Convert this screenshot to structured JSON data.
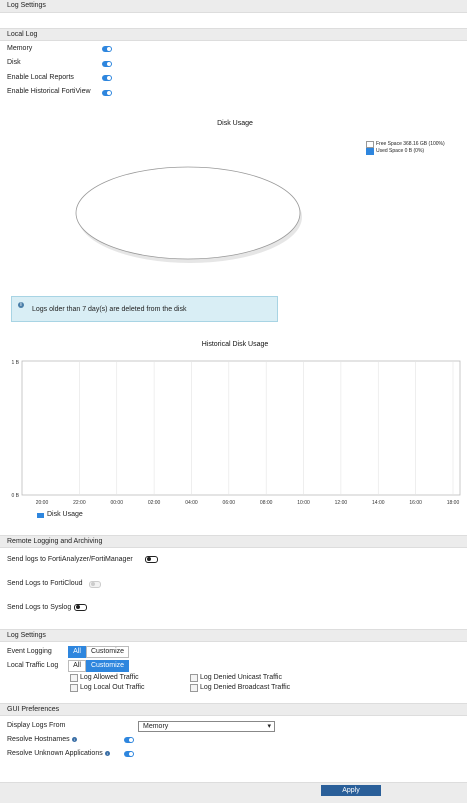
{
  "header": {
    "title": "Log Settings"
  },
  "local_log": {
    "section_title": "Local Log",
    "items": [
      {
        "label": "Memory",
        "enabled": true
      },
      {
        "label": "Disk",
        "enabled": true
      },
      {
        "label": "Enable Local Reports",
        "enabled": true
      },
      {
        "label": "Enable Historical FortiView",
        "enabled": true
      }
    ]
  },
  "disk_usage": {
    "title": "Disk Usage",
    "legend_free": "Free Space 368.16 GB (100%)",
    "legend_used": "Used Space 0 B (0%)",
    "free_color": "#ffffff",
    "used_color": "#2e86de"
  },
  "info_notice": {
    "text": "Logs older than 7 day(s) are deleted from the disk"
  },
  "historical": {
    "title": "Historical Disk Usage",
    "legend": "Disk Usage"
  },
  "chart_data": {
    "type": "line",
    "title": "Historical Disk Usage",
    "x": [
      "20:00",
      "22:00",
      "00:00",
      "02:00",
      "04:00",
      "06:00",
      "08:00",
      "10:00",
      "12:00",
      "14:00",
      "16:00",
      "18:00"
    ],
    "series": [
      {
        "name": "Disk Usage",
        "values": []
      }
    ],
    "yticks": [
      "1 B",
      "0 B"
    ],
    "ylim": [
      0,
      1
    ],
    "grid": true,
    "legend": "bottom-left"
  },
  "remote": {
    "section_title": "Remote Logging and Archiving",
    "items": [
      {
        "label": "Send logs to FortiAnalyzer/FortiManager",
        "state": "off"
      },
      {
        "label": "Send Logs to FortiCloud",
        "state": "disabled"
      },
      {
        "label": "Send Logs to Syslog",
        "state": "off"
      }
    ]
  },
  "log_settings": {
    "section_title": "Log Settings",
    "event_logging": {
      "label": "Event Logging",
      "all": "All",
      "customize": "Customize",
      "selected": "All"
    },
    "local_traffic": {
      "label": "Local Traffic Log",
      "all": "All",
      "customize": "Customize",
      "selected": "Customize"
    },
    "checkboxes": {
      "allowed": "Log Allowed Traffic",
      "local_out": "Log Local Out Traffic",
      "denied_unicast": "Log Denied Unicast Traffic",
      "denied_broadcast": "Log Denied Broadcast Traffic"
    }
  },
  "gui": {
    "section_title": "GUI Preferences",
    "display_label": "Display Logs From",
    "display_value": "Memory",
    "resolve_hostnames": "Resolve Hostnames",
    "resolve_apps": "Resolve Unknown Applications"
  },
  "footer": {
    "apply": "Apply"
  }
}
